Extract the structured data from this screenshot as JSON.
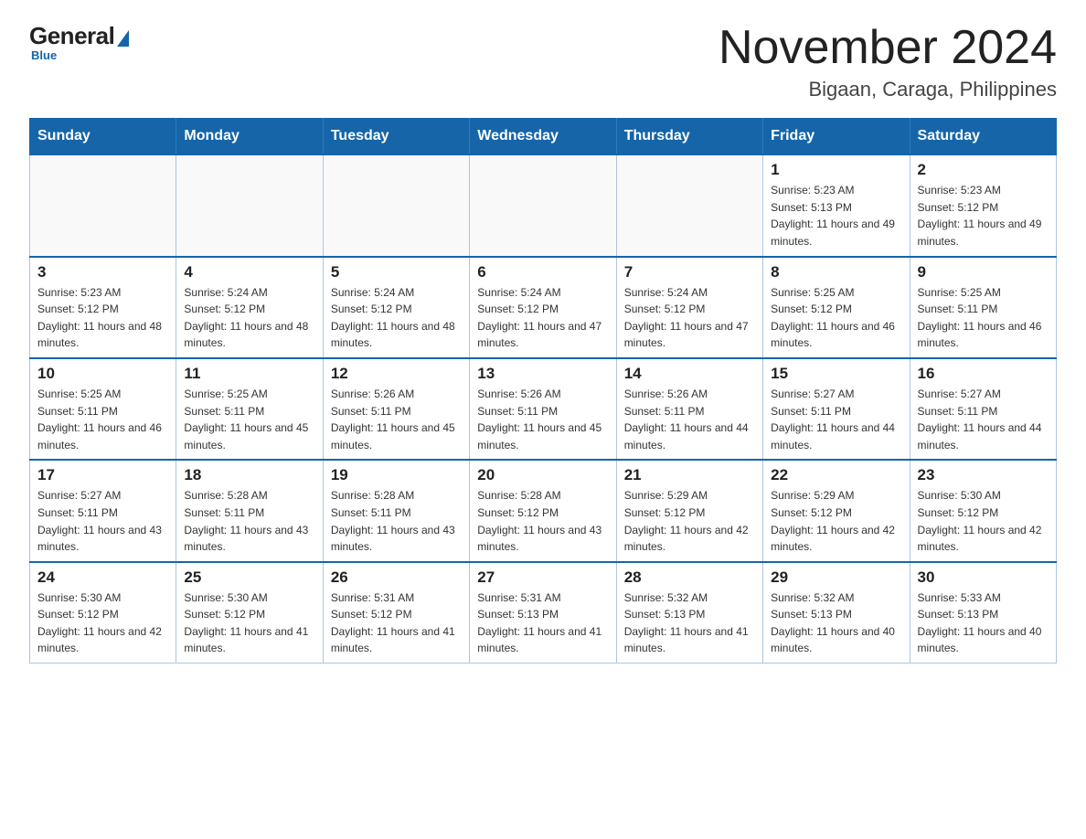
{
  "logo": {
    "general": "General",
    "blue": "Blue",
    "subtitle": "Blue"
  },
  "header": {
    "month_year": "November 2024",
    "location": "Bigaan, Caraga, Philippines"
  },
  "weekdays": [
    "Sunday",
    "Monday",
    "Tuesday",
    "Wednesday",
    "Thursday",
    "Friday",
    "Saturday"
  ],
  "weeks": [
    [
      {
        "day": "",
        "sunrise": "",
        "sunset": "",
        "daylight": ""
      },
      {
        "day": "",
        "sunrise": "",
        "sunset": "",
        "daylight": ""
      },
      {
        "day": "",
        "sunrise": "",
        "sunset": "",
        "daylight": ""
      },
      {
        "day": "",
        "sunrise": "",
        "sunset": "",
        "daylight": ""
      },
      {
        "day": "",
        "sunrise": "",
        "sunset": "",
        "daylight": ""
      },
      {
        "day": "1",
        "sunrise": "Sunrise: 5:23 AM",
        "sunset": "Sunset: 5:13 PM",
        "daylight": "Daylight: 11 hours and 49 minutes."
      },
      {
        "day": "2",
        "sunrise": "Sunrise: 5:23 AM",
        "sunset": "Sunset: 5:12 PM",
        "daylight": "Daylight: 11 hours and 49 minutes."
      }
    ],
    [
      {
        "day": "3",
        "sunrise": "Sunrise: 5:23 AM",
        "sunset": "Sunset: 5:12 PM",
        "daylight": "Daylight: 11 hours and 48 minutes."
      },
      {
        "day": "4",
        "sunrise": "Sunrise: 5:24 AM",
        "sunset": "Sunset: 5:12 PM",
        "daylight": "Daylight: 11 hours and 48 minutes."
      },
      {
        "day": "5",
        "sunrise": "Sunrise: 5:24 AM",
        "sunset": "Sunset: 5:12 PM",
        "daylight": "Daylight: 11 hours and 48 minutes."
      },
      {
        "day": "6",
        "sunrise": "Sunrise: 5:24 AM",
        "sunset": "Sunset: 5:12 PM",
        "daylight": "Daylight: 11 hours and 47 minutes."
      },
      {
        "day": "7",
        "sunrise": "Sunrise: 5:24 AM",
        "sunset": "Sunset: 5:12 PM",
        "daylight": "Daylight: 11 hours and 47 minutes."
      },
      {
        "day": "8",
        "sunrise": "Sunrise: 5:25 AM",
        "sunset": "Sunset: 5:12 PM",
        "daylight": "Daylight: 11 hours and 46 minutes."
      },
      {
        "day": "9",
        "sunrise": "Sunrise: 5:25 AM",
        "sunset": "Sunset: 5:11 PM",
        "daylight": "Daylight: 11 hours and 46 minutes."
      }
    ],
    [
      {
        "day": "10",
        "sunrise": "Sunrise: 5:25 AM",
        "sunset": "Sunset: 5:11 PM",
        "daylight": "Daylight: 11 hours and 46 minutes."
      },
      {
        "day": "11",
        "sunrise": "Sunrise: 5:25 AM",
        "sunset": "Sunset: 5:11 PM",
        "daylight": "Daylight: 11 hours and 45 minutes."
      },
      {
        "day": "12",
        "sunrise": "Sunrise: 5:26 AM",
        "sunset": "Sunset: 5:11 PM",
        "daylight": "Daylight: 11 hours and 45 minutes."
      },
      {
        "day": "13",
        "sunrise": "Sunrise: 5:26 AM",
        "sunset": "Sunset: 5:11 PM",
        "daylight": "Daylight: 11 hours and 45 minutes."
      },
      {
        "day": "14",
        "sunrise": "Sunrise: 5:26 AM",
        "sunset": "Sunset: 5:11 PM",
        "daylight": "Daylight: 11 hours and 44 minutes."
      },
      {
        "day": "15",
        "sunrise": "Sunrise: 5:27 AM",
        "sunset": "Sunset: 5:11 PM",
        "daylight": "Daylight: 11 hours and 44 minutes."
      },
      {
        "day": "16",
        "sunrise": "Sunrise: 5:27 AM",
        "sunset": "Sunset: 5:11 PM",
        "daylight": "Daylight: 11 hours and 44 minutes."
      }
    ],
    [
      {
        "day": "17",
        "sunrise": "Sunrise: 5:27 AM",
        "sunset": "Sunset: 5:11 PM",
        "daylight": "Daylight: 11 hours and 43 minutes."
      },
      {
        "day": "18",
        "sunrise": "Sunrise: 5:28 AM",
        "sunset": "Sunset: 5:11 PM",
        "daylight": "Daylight: 11 hours and 43 minutes."
      },
      {
        "day": "19",
        "sunrise": "Sunrise: 5:28 AM",
        "sunset": "Sunset: 5:11 PM",
        "daylight": "Daylight: 11 hours and 43 minutes."
      },
      {
        "day": "20",
        "sunrise": "Sunrise: 5:28 AM",
        "sunset": "Sunset: 5:12 PM",
        "daylight": "Daylight: 11 hours and 43 minutes."
      },
      {
        "day": "21",
        "sunrise": "Sunrise: 5:29 AM",
        "sunset": "Sunset: 5:12 PM",
        "daylight": "Daylight: 11 hours and 42 minutes."
      },
      {
        "day": "22",
        "sunrise": "Sunrise: 5:29 AM",
        "sunset": "Sunset: 5:12 PM",
        "daylight": "Daylight: 11 hours and 42 minutes."
      },
      {
        "day": "23",
        "sunrise": "Sunrise: 5:30 AM",
        "sunset": "Sunset: 5:12 PM",
        "daylight": "Daylight: 11 hours and 42 minutes."
      }
    ],
    [
      {
        "day": "24",
        "sunrise": "Sunrise: 5:30 AM",
        "sunset": "Sunset: 5:12 PM",
        "daylight": "Daylight: 11 hours and 42 minutes."
      },
      {
        "day": "25",
        "sunrise": "Sunrise: 5:30 AM",
        "sunset": "Sunset: 5:12 PM",
        "daylight": "Daylight: 11 hours and 41 minutes."
      },
      {
        "day": "26",
        "sunrise": "Sunrise: 5:31 AM",
        "sunset": "Sunset: 5:12 PM",
        "daylight": "Daylight: 11 hours and 41 minutes."
      },
      {
        "day": "27",
        "sunrise": "Sunrise: 5:31 AM",
        "sunset": "Sunset: 5:13 PM",
        "daylight": "Daylight: 11 hours and 41 minutes."
      },
      {
        "day": "28",
        "sunrise": "Sunrise: 5:32 AM",
        "sunset": "Sunset: 5:13 PM",
        "daylight": "Daylight: 11 hours and 41 minutes."
      },
      {
        "day": "29",
        "sunrise": "Sunrise: 5:32 AM",
        "sunset": "Sunset: 5:13 PM",
        "daylight": "Daylight: 11 hours and 40 minutes."
      },
      {
        "day": "30",
        "sunrise": "Sunrise: 5:33 AM",
        "sunset": "Sunset: 5:13 PM",
        "daylight": "Daylight: 11 hours and 40 minutes."
      }
    ]
  ]
}
